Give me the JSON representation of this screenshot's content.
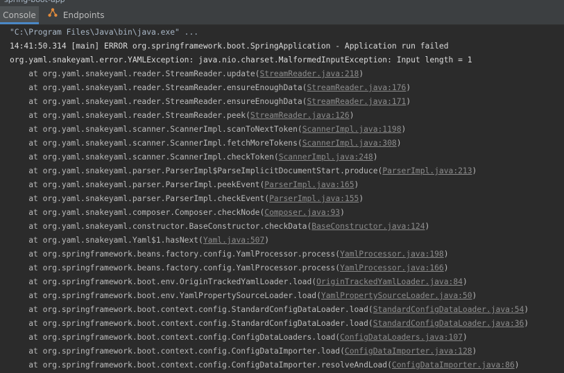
{
  "window": {
    "run_label": "spring-boot-app"
  },
  "tabs": [
    {
      "label": "Console",
      "active": true
    },
    {
      "label": "Endpoints",
      "icon": "endpoints-icon"
    }
  ],
  "colors": {
    "background": "#2b2b2b",
    "text": "#bbbbbb",
    "link": "#8c8c8c",
    "tab_active": "#4e5254"
  },
  "console": {
    "command": "\"C:\\Program Files\\Java\\bin\\java.exe\" ...",
    "error_line": "14:41:50.314 [main] ERROR org.springframework.boot.SpringApplication - Application run failed",
    "exception_line": "org.yaml.snakeyaml.error.YAMLException: java.nio.charset.MalformedInputException: Input length = 1",
    "frames": [
      {
        "method": "org.yaml.snakeyaml.reader.StreamReader.update",
        "location": "StreamReader.java:218"
      },
      {
        "method": "org.yaml.snakeyaml.reader.StreamReader.ensureEnoughData",
        "location": "StreamReader.java:176"
      },
      {
        "method": "org.yaml.snakeyaml.reader.StreamReader.ensureEnoughData",
        "location": "StreamReader.java:171"
      },
      {
        "method": "org.yaml.snakeyaml.reader.StreamReader.peek",
        "location": "StreamReader.java:126"
      },
      {
        "method": "org.yaml.snakeyaml.scanner.ScannerImpl.scanToNextToken",
        "location": "ScannerImpl.java:1198"
      },
      {
        "method": "org.yaml.snakeyaml.scanner.ScannerImpl.fetchMoreTokens",
        "location": "ScannerImpl.java:308"
      },
      {
        "method": "org.yaml.snakeyaml.scanner.ScannerImpl.checkToken",
        "location": "ScannerImpl.java:248"
      },
      {
        "method": "org.yaml.snakeyaml.parser.ParserImpl$ParseImplicitDocumentStart.produce",
        "location": "ParserImpl.java:213"
      },
      {
        "method": "org.yaml.snakeyaml.parser.ParserImpl.peekEvent",
        "location": "ParserImpl.java:165"
      },
      {
        "method": "org.yaml.snakeyaml.parser.ParserImpl.checkEvent",
        "location": "ParserImpl.java:155"
      },
      {
        "method": "org.yaml.snakeyaml.composer.Composer.checkNode",
        "location": "Composer.java:93"
      },
      {
        "method": "org.yaml.snakeyaml.constructor.BaseConstructor.checkData",
        "location": "BaseConstructor.java:124"
      },
      {
        "method": "org.yaml.snakeyaml.Yaml$1.hasNext",
        "location": "Yaml.java:507"
      },
      {
        "method": "org.springframework.beans.factory.config.YamlProcessor.process",
        "location": "YamlProcessor.java:198"
      },
      {
        "method": "org.springframework.beans.factory.config.YamlProcessor.process",
        "location": "YamlProcessor.java:166"
      },
      {
        "method": "org.springframework.boot.env.OriginTrackedYamlLoader.load",
        "location": "OriginTrackedYamlLoader.java:84"
      },
      {
        "method": "org.springframework.boot.env.YamlPropertySourceLoader.load",
        "location": "YamlPropertySourceLoader.java:50"
      },
      {
        "method": "org.springframework.boot.context.config.StandardConfigDataLoader.load",
        "location": "StandardConfigDataLoader.java:54"
      },
      {
        "method": "org.springframework.boot.context.config.StandardConfigDataLoader.load",
        "location": "StandardConfigDataLoader.java:36"
      },
      {
        "method": "org.springframework.boot.context.config.ConfigDataLoaders.load",
        "location": "ConfigDataLoaders.java:107"
      },
      {
        "method": "org.springframework.boot.context.config.ConfigDataImporter.load",
        "location": "ConfigDataImporter.java:128"
      },
      {
        "method": "org.springframework.boot.context.config.ConfigDataImporter.resolveAndLoad",
        "location": "ConfigDataImporter.java:86"
      }
    ]
  }
}
